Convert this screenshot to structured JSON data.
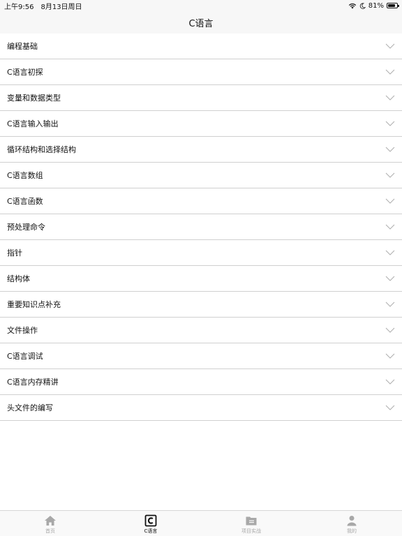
{
  "status_bar": {
    "time": "上午9:56",
    "date": "8月13日周日",
    "battery_percent": "81%",
    "battery_level": 0.81
  },
  "nav": {
    "title": "C语言"
  },
  "list": {
    "items": [
      {
        "label": "编程基础"
      },
      {
        "label": "C语言初探"
      },
      {
        "label": "变量和数据类型"
      },
      {
        "label": "C语言输入输出"
      },
      {
        "label": "循环结构和选择结构"
      },
      {
        "label": "C语言数组"
      },
      {
        "label": "C语言函数"
      },
      {
        "label": "预处理命令"
      },
      {
        "label": "指针"
      },
      {
        "label": "结构体"
      },
      {
        "label": "重要知识点补充"
      },
      {
        "label": "文件操作"
      },
      {
        "label": "C语言调试"
      },
      {
        "label": "C语言内存精讲"
      },
      {
        "label": "头文件的编写"
      }
    ]
  },
  "tab_bar": {
    "tabs": [
      {
        "label": "首页",
        "icon": "home-icon",
        "active": false
      },
      {
        "label": "C语言",
        "icon": "c-language-icon",
        "active": true
      },
      {
        "label": "项目实战",
        "icon": "folder-icon",
        "active": false
      },
      {
        "label": "我的",
        "icon": "user-icon",
        "active": false
      }
    ]
  },
  "colors": {
    "active_tab": "#111111",
    "inactive_tab": "#a8a8a8",
    "divider": "#d0d0d0",
    "chevron": "#b0b0b0"
  }
}
